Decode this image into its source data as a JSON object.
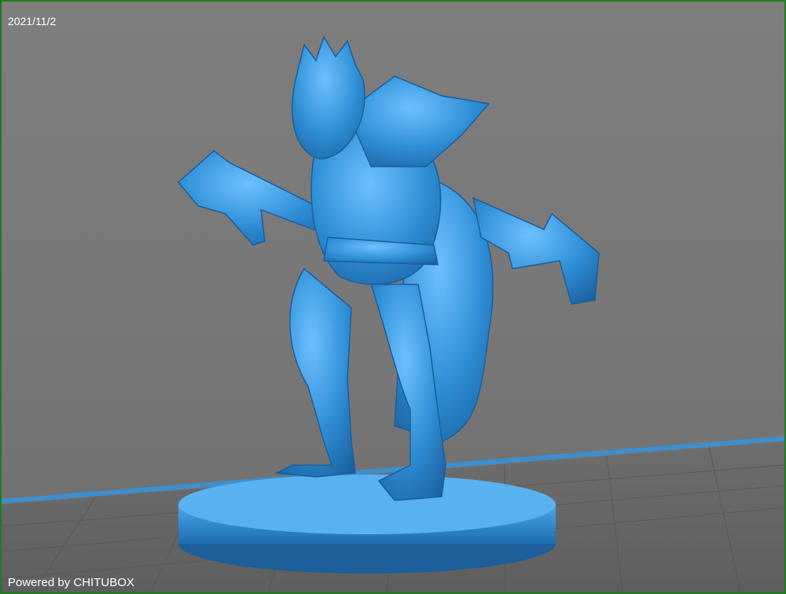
{
  "viewport": {
    "date": "2021/11/2",
    "watermark": "Powered by CHITUBOX"
  },
  "colors": {
    "background": "#7a7a7a",
    "frame": "#1c7d1c",
    "model": "#2f8fd6",
    "build_plate_edge": "#3d8fd0",
    "grid": "#5a5a5a"
  },
  "scene": {
    "object": "miniature-warrior-model",
    "objects": [
      "build-plate",
      "model-base",
      "miniature-warrior-model"
    ]
  }
}
